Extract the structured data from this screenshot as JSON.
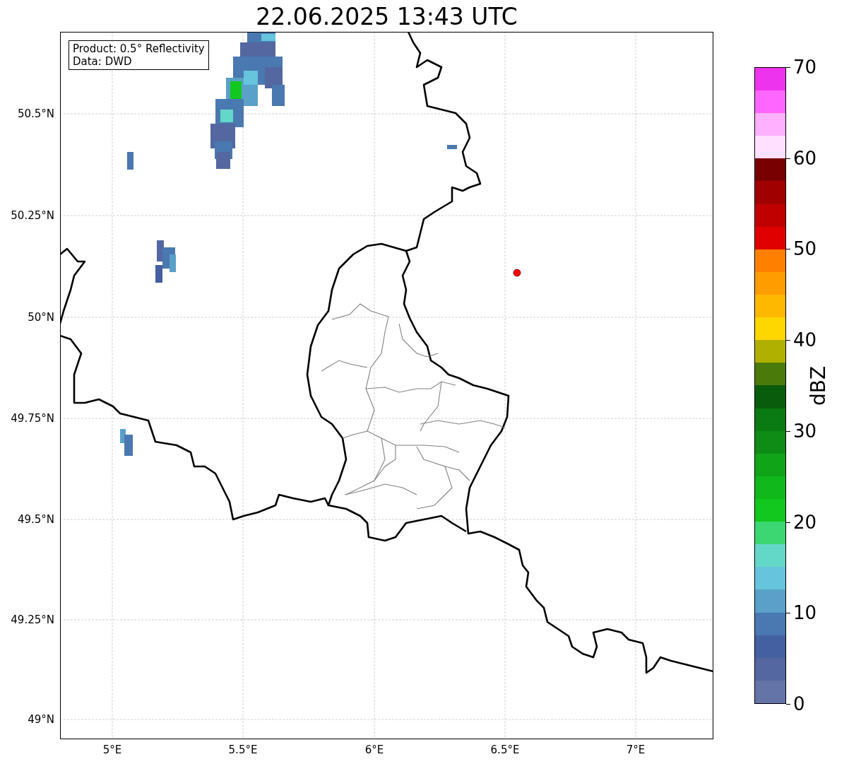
{
  "title": "22.06.2025 13:43 UTC",
  "map": {
    "info_box": [
      "Product: 0.5° Reflectivity",
      "Data: DWD"
    ],
    "x_ticks": [
      "5°E",
      "5.5°E",
      "6°E",
      "6.5°E",
      "7°E"
    ],
    "y_ticks": [
      "50.5°N",
      "50.25°N",
      "50°N",
      "49.75°N",
      "49.5°N",
      "49.25°N",
      "49°N"
    ]
  },
  "colorbar": {
    "label": "dBZ",
    "ticks": [
      "70",
      "60",
      "50",
      "40",
      "30",
      "20",
      "10",
      "0"
    ],
    "bins": [
      {
        "color": "#6473a8"
      },
      {
        "color": "#5467a0"
      },
      {
        "color": "#4460a0"
      },
      {
        "color": "#4a78b0"
      },
      {
        "color": "#5aa0c8"
      },
      {
        "color": "#66c4dc"
      },
      {
        "color": "#64d8c8"
      },
      {
        "color": "#3cd672"
      },
      {
        "color": "#12c81e"
      },
      {
        "color": "#10b81c"
      },
      {
        "color": "#10a418"
      },
      {
        "color": "#0e8c16"
      },
      {
        "color": "#0a7a12"
      },
      {
        "color": "#085c0c"
      },
      {
        "color": "#4a7a0a"
      },
      {
        "color": "#b0b000"
      },
      {
        "color": "#ffd700"
      },
      {
        "color": "#ffb800"
      },
      {
        "color": "#ff9c00"
      },
      {
        "color": "#ff8000"
      },
      {
        "color": "#e00000"
      },
      {
        "color": "#c00000"
      },
      {
        "color": "#a00000"
      },
      {
        "color": "#780000"
      },
      {
        "color": "#ffe0ff"
      },
      {
        "color": "#ffb0ff"
      },
      {
        "color": "#ff66ff"
      },
      {
        "color": "#ee33ee"
      }
    ]
  }
}
